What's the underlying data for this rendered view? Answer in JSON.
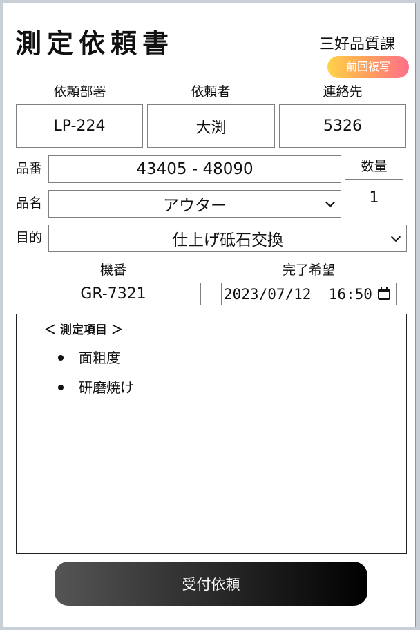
{
  "header": {
    "title": "測定依頼書",
    "department": "三好品質課",
    "prev_copy_label": "前回複写"
  },
  "requester": {
    "dept_label": "依頼部署",
    "dept_value": "LP-224",
    "person_label": "依頼者",
    "person_value": "大渕",
    "contact_label": "連絡先",
    "contact_value": "5326"
  },
  "part": {
    "number_label": "品番",
    "number_value": "43405 - 48090",
    "name_label": "品名",
    "name_value": "アウター",
    "quantity_label": "数量",
    "quantity_value": "1"
  },
  "purpose": {
    "label": "目的",
    "value": "仕上げ砥石交換"
  },
  "machine": {
    "label": "機番",
    "value": "GR-7321"
  },
  "completion": {
    "label": "完了希望",
    "value": "2023/07/12  16:50"
  },
  "items": {
    "heading": "＜ 測定項目 ＞",
    "list": [
      "面粗度",
      "研磨焼け"
    ]
  },
  "submit_label": "受付依頼",
  "icons": {
    "calendar": "calendar-icon",
    "dropdown": "chevron-down-icon"
  },
  "colors": {
    "prev_btn_gradient_start": "#ffd24a",
    "prev_btn_gradient_end": "#ff6f8a",
    "submit_gradient_start": "#555555",
    "submit_gradient_end": "#000000"
  }
}
